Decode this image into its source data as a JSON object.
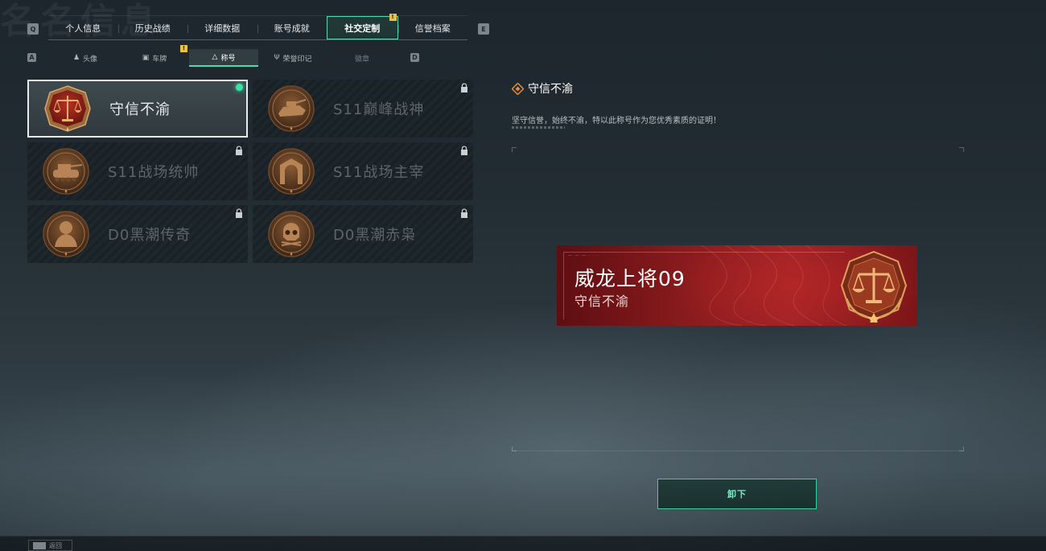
{
  "page": {
    "ghost_title": "名名信息"
  },
  "keys": {
    "prev_tab": "Q",
    "next_tab": "E",
    "prev_sub": "A",
    "next_sub": "D"
  },
  "tabs": [
    {
      "label": "个人信息",
      "active": false
    },
    {
      "label": "历史战绩",
      "active": false
    },
    {
      "label": "详细数据",
      "active": false
    },
    {
      "label": "账号成就",
      "active": false
    },
    {
      "label": "社交定制",
      "active": true,
      "badge": "!"
    },
    {
      "label": "信誉档案",
      "active": false
    }
  ],
  "subtabs": [
    {
      "label": "头像",
      "icon": "person-icon"
    },
    {
      "label": "车牌",
      "icon": "plate-icon",
      "badge": "!"
    },
    {
      "label": "称号",
      "icon": "title-icon",
      "active": true
    },
    {
      "label": "荣誉印记",
      "icon": "honor-mark-icon"
    },
    {
      "label": "徽章",
      "icon": ""
    }
  ],
  "titles": [
    {
      "label": "守信不渝",
      "active": true,
      "locked": false,
      "medal": "scales-medal-icon"
    },
    {
      "label": "S11巅峰战神",
      "active": false,
      "locked": true,
      "medal": "tank-medal-icon"
    },
    {
      "label": "S11战场统帅",
      "active": false,
      "locked": true,
      "medal": "tank-medal-icon"
    },
    {
      "label": "S11战场主宰",
      "active": false,
      "locked": true,
      "medal": "gate-medal-icon"
    },
    {
      "label": "D0黑潮传奇",
      "active": false,
      "locked": true,
      "medal": "soldier-medal-icon"
    },
    {
      "label": "D0黑潮赤枭",
      "active": false,
      "locked": true,
      "medal": "skull-medal-icon"
    }
  ],
  "detail": {
    "title": "守信不渝",
    "description": "坚守信誉，始终不渝，特以此称号作为您优秀素质的证明！"
  },
  "nameplate": {
    "player_name": "威龙上将09",
    "title": "守信不渝"
  },
  "actions": {
    "unequip": "卸下",
    "back": "返回"
  },
  "colors": {
    "accent": "#56d7b1",
    "plate_red": "#a22326",
    "badge": "#e6c24a"
  }
}
